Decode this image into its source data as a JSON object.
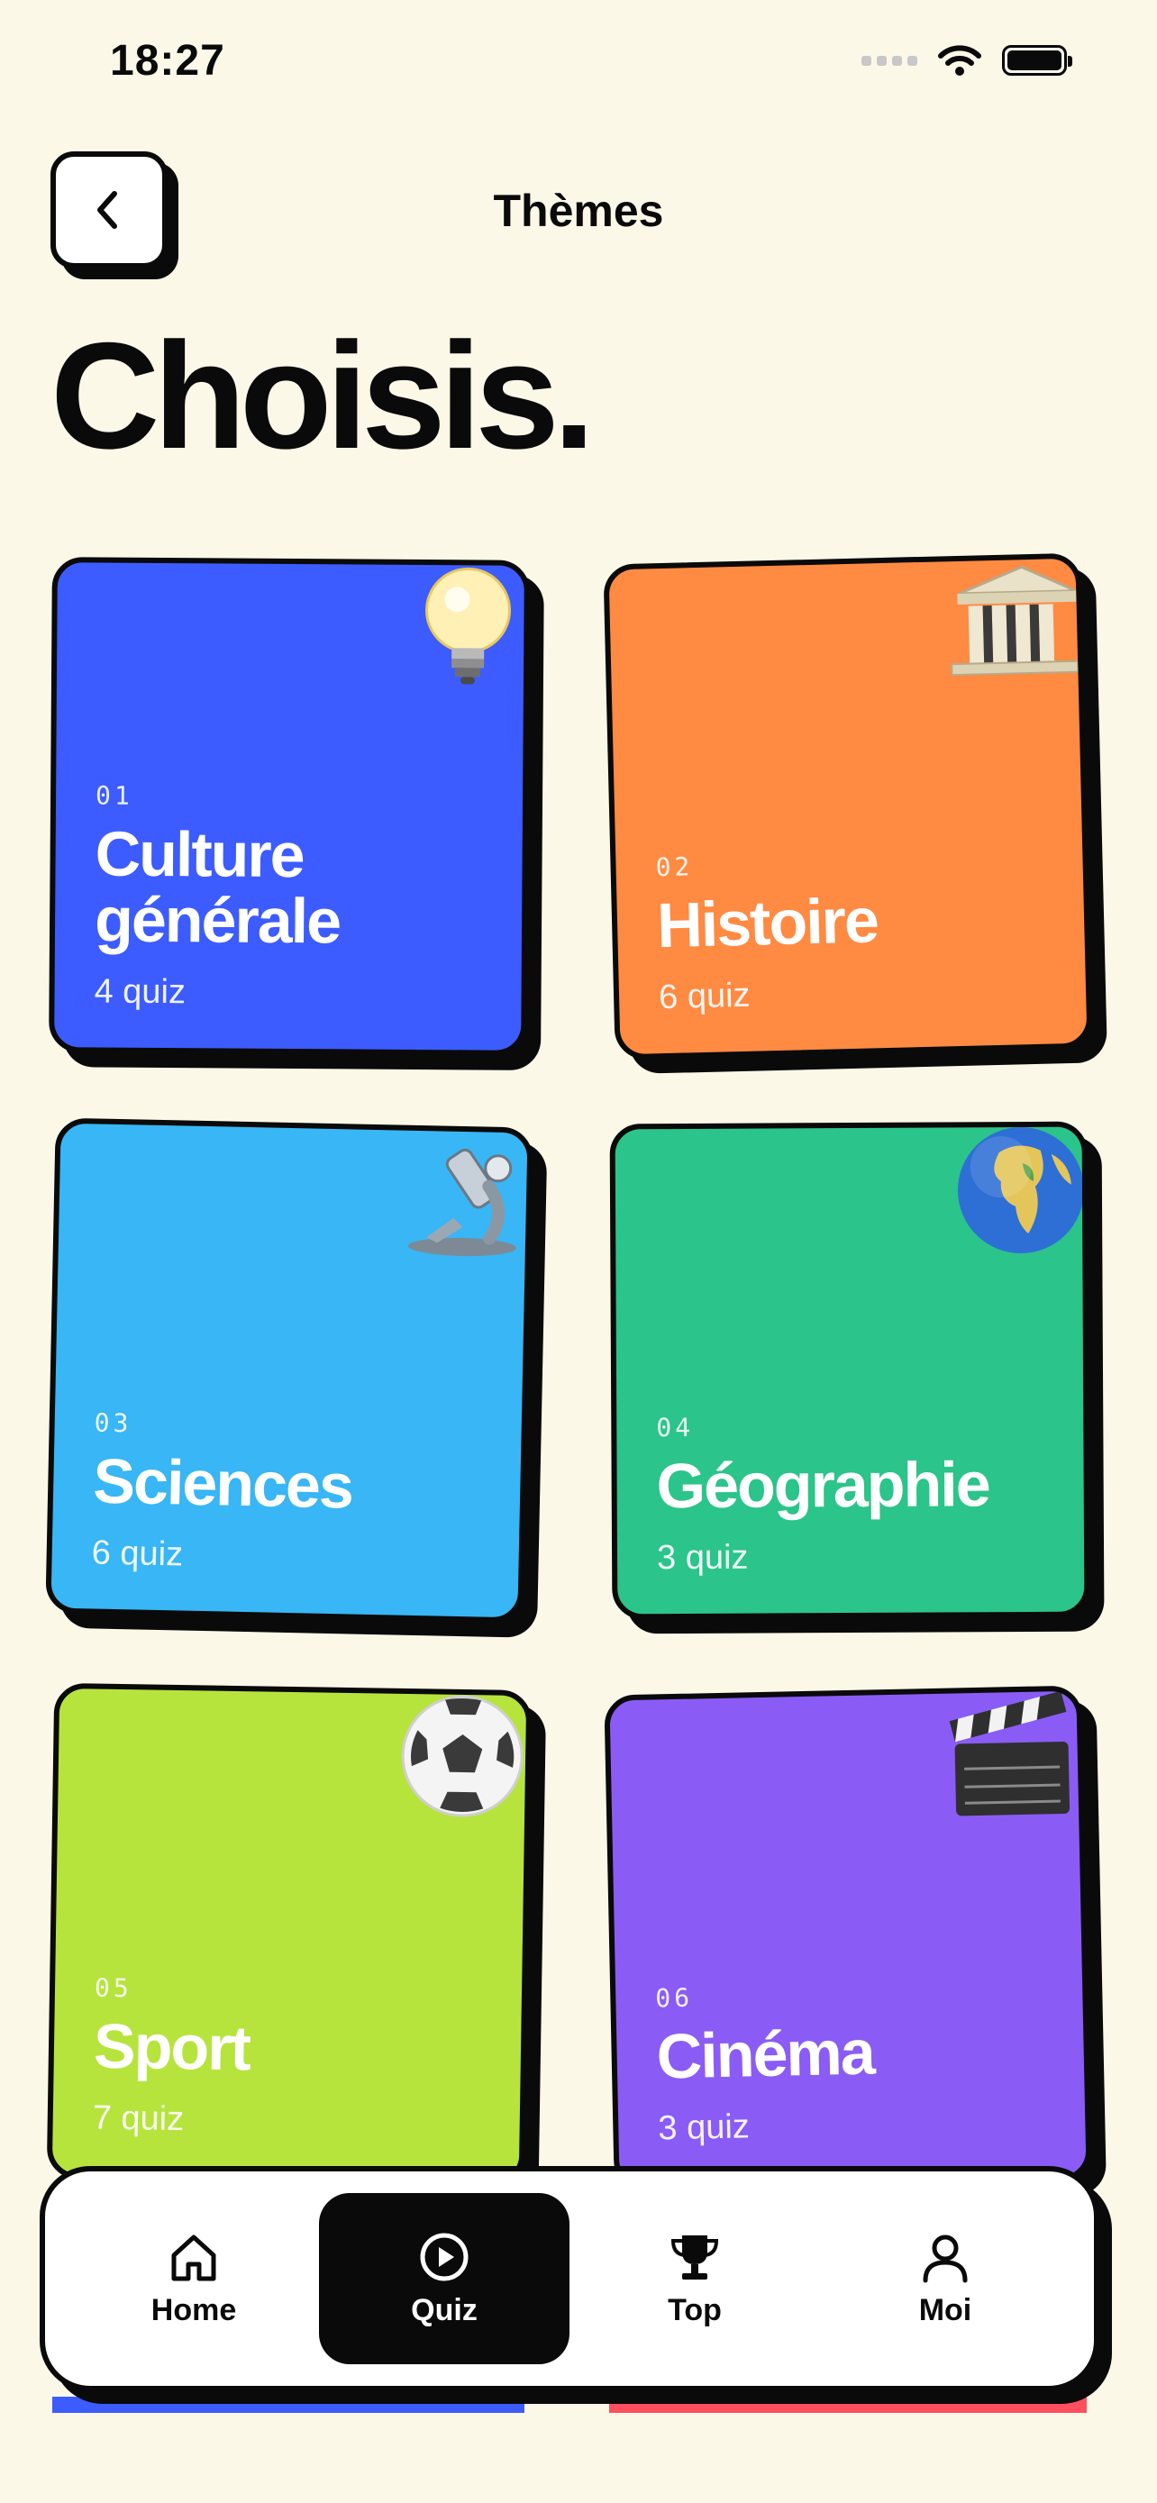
{
  "status_bar": {
    "time": "18:27"
  },
  "header": {
    "title": "Thèmes",
    "back_icon": "chevron-left-icon"
  },
  "page": {
    "title": "Choisis."
  },
  "themes": [
    {
      "num": "01",
      "title": "Culture générale",
      "count": "4 quiz",
      "color": "#3C5CFF",
      "icon": "lightbulb-icon"
    },
    {
      "num": "02",
      "title": "Histoire",
      "count": "6 quiz",
      "color": "#FF8A42",
      "icon": "classical-building-icon"
    },
    {
      "num": "03",
      "title": "Sciences",
      "count": "6 quiz",
      "color": "#38B6F5",
      "icon": "microscope-icon"
    },
    {
      "num": "04",
      "title": "Géographie",
      "count": "3 quiz",
      "color": "#2BC48A",
      "icon": "globe-icon"
    },
    {
      "num": "05",
      "title": "Sport",
      "count": "7 quiz",
      "color": "#B6E43C",
      "icon": "soccer-ball-icon"
    },
    {
      "num": "06",
      "title": "Cinéma",
      "count": "3 quiz",
      "color": "#8A5CF5",
      "icon": "clapper-board-icon"
    }
  ],
  "tab_bar": {
    "active": "Quiz",
    "tabs": [
      {
        "label": "Home",
        "icon": "home-icon"
      },
      {
        "label": "Quiz",
        "icon": "play-circle-icon"
      },
      {
        "label": "Top",
        "icon": "trophy-icon"
      },
      {
        "label": "Moi",
        "icon": "user-icon"
      }
    ]
  }
}
